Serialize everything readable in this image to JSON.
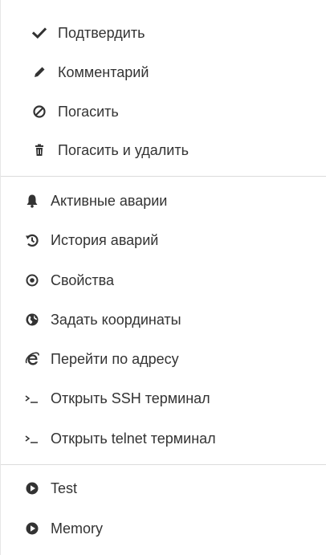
{
  "menu": {
    "group1": [
      {
        "label": "Подтвердить",
        "icon": "check-icon"
      },
      {
        "label": "Комментарий",
        "icon": "pencil-icon"
      },
      {
        "label": "Погасить",
        "icon": "ban-icon"
      },
      {
        "label": "Погасить и удалить",
        "icon": "trash-icon"
      }
    ],
    "group2": [
      {
        "label": "Активные аварии",
        "icon": "bell-icon"
      },
      {
        "label": "История аварий",
        "icon": "history-icon"
      },
      {
        "label": "Свойства",
        "icon": "dot-circle-icon"
      },
      {
        "label": "Задать координаты",
        "icon": "globe-icon"
      },
      {
        "label": "Перейти по адресу",
        "icon": "internet-explorer-icon"
      },
      {
        "label": "Открыть SSH терминал",
        "icon": "terminal-icon"
      },
      {
        "label": "Открыть telnet терминал",
        "icon": "terminal-icon"
      }
    ],
    "group3": [
      {
        "label": "Test",
        "icon": "play-circle-icon"
      },
      {
        "label": "Memory",
        "icon": "play-circle-icon"
      }
    ]
  },
  "colors": {
    "text": "#333333",
    "icon": "#333333",
    "separator": "#dcdcdc",
    "background": "#ffffff"
  }
}
